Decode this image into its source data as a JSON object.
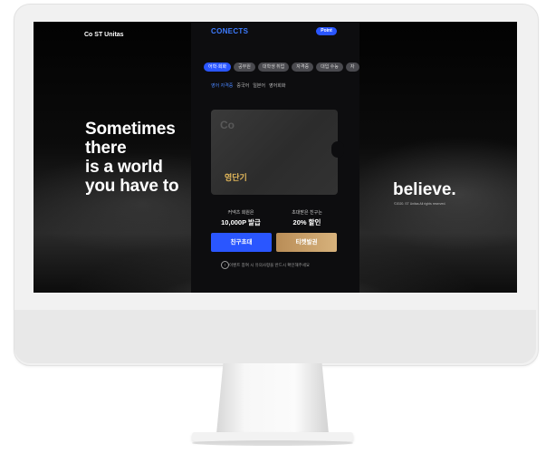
{
  "site": {
    "logo_text": "Co ST Unitas",
    "headline_lines": [
      "Sometimes",
      "there",
      "is a world",
      "you have to"
    ],
    "headline_end": "believe.",
    "copyright": "©2020. ST Unitas All rights reserved."
  },
  "app": {
    "brand": "CONECTS",
    "point_badge": "Point",
    "tabs": [
      "어학·회화",
      "공무원",
      "대학생 취업",
      "자격증",
      "대입 수능",
      "자"
    ],
    "subtabs": [
      "영어 자격증",
      "중국어",
      "일본어",
      "영어회화"
    ],
    "card": {
      "label": "영단기"
    },
    "stats": [
      {
        "label": "커넥츠 회원은",
        "value": "10,000P 발급"
      },
      {
        "label": "초대받은 친구는",
        "value": "20% 할인"
      }
    ],
    "buttons": {
      "invite": "친구초대",
      "ticket": "티켓발권"
    },
    "notice": "이벤트 참여 시 유의사항을 반드시 확인해주세요"
  },
  "colors": {
    "accent": "#2a56ff",
    "gold": "#c8a06a",
    "card_label": "#e2b75a"
  }
}
